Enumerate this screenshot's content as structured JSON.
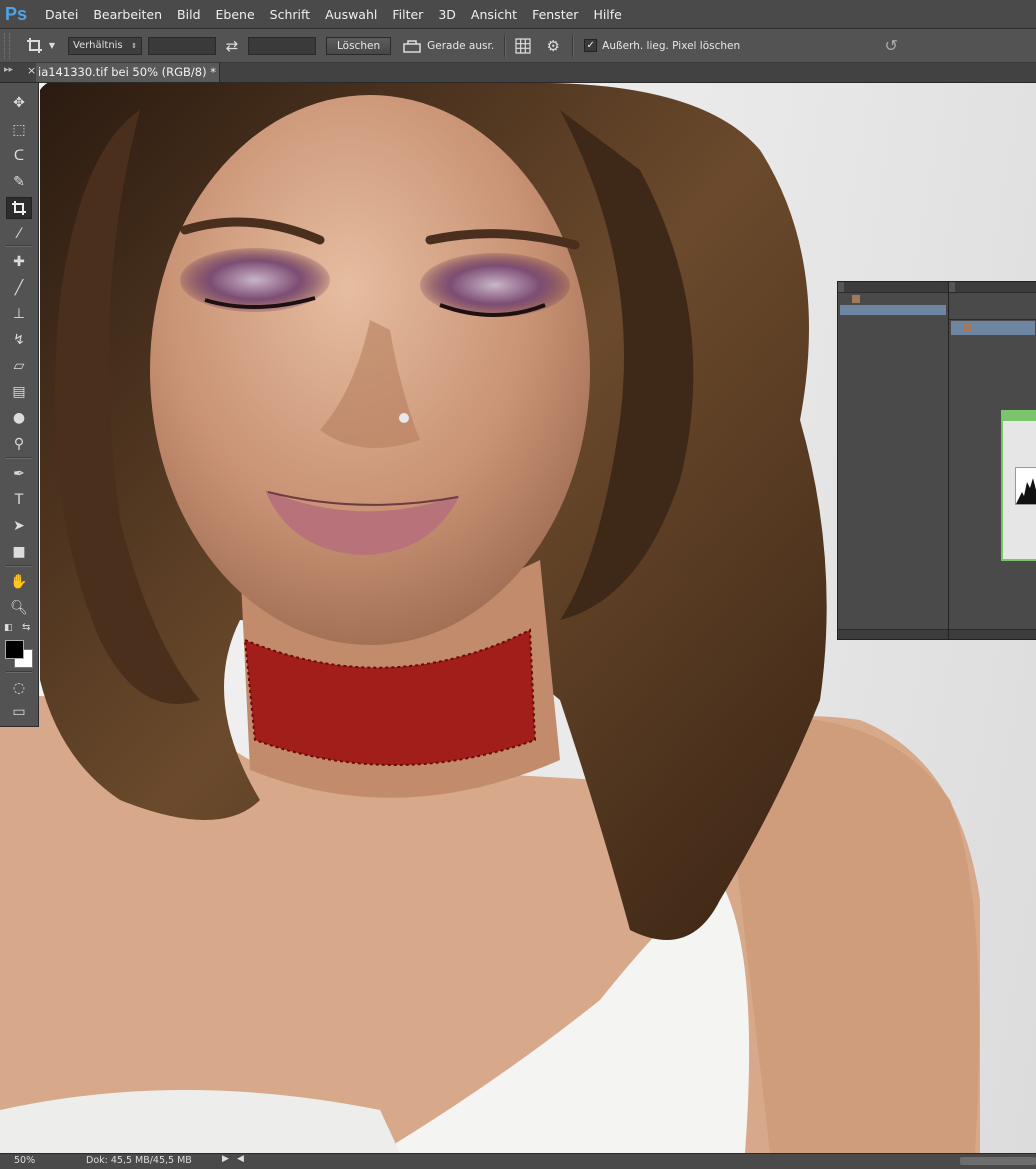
{
  "app": {
    "logo": "Ps"
  },
  "menu": [
    "Datei",
    "Bearbeiten",
    "Bild",
    "Ebene",
    "Schrift",
    "Auswahl",
    "Filter",
    "3D",
    "Ansicht",
    "Fenster",
    "Hilfe"
  ],
  "options_bar": {
    "ratio_select": "Verhältnis",
    "width_value": "",
    "height_value": "",
    "clear_button": "Löschen",
    "straighten_label": "Gerade ausr.",
    "delete_cropped_label": "Außerh. lieg. Pixel löschen",
    "delete_cropped_checked": true
  },
  "document_tab": {
    "title": "ia141330.tif bei 50% (RGB/8) *"
  },
  "tools": [
    "move-tool",
    "marquee-tool",
    "lasso-tool",
    "quick-selection-tool",
    "crop-tool",
    "eyedropper-tool",
    "healing-brush-tool",
    "brush-tool",
    "clone-stamp-tool",
    "history-brush-tool",
    "eraser-tool",
    "gradient-tool",
    "blur-tool",
    "dodge-tool",
    "pen-tool",
    "type-tool",
    "path-selection-tool",
    "rectangle-tool",
    "hand-tool",
    "zoom-tool"
  ],
  "active_tool": "crop-tool",
  "colors": {
    "foreground": "#000000",
    "background": "#ffffff",
    "accent": "#4fa3e8",
    "dialog_border": "#7bc46b"
  },
  "status": {
    "zoom": "50%",
    "doc_size": "Dok: 45,5 MB/45,5 MB"
  }
}
